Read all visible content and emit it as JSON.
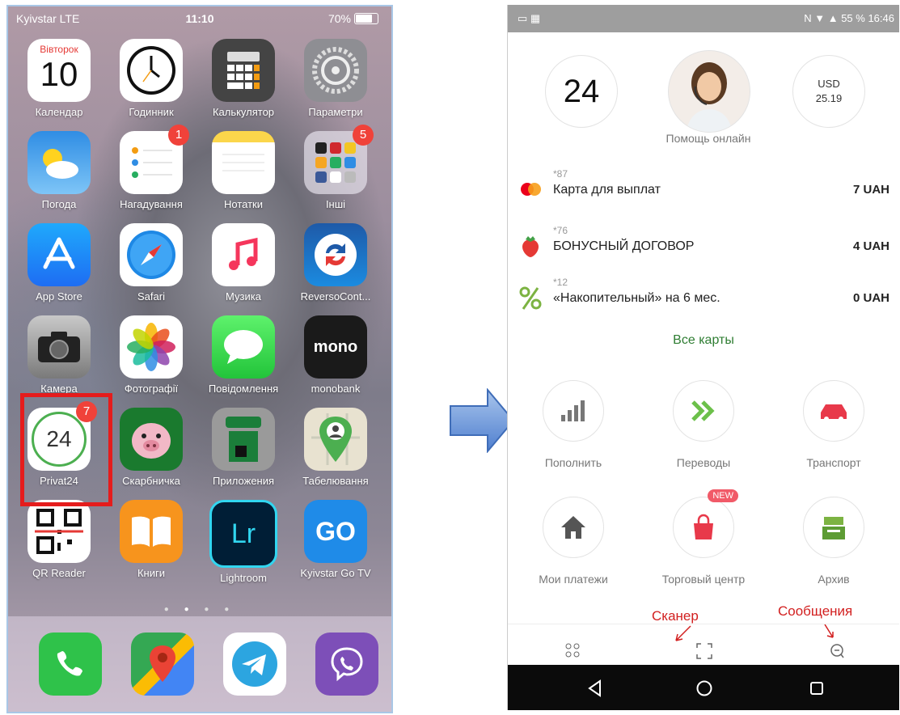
{
  "iphone": {
    "status": {
      "carrier": "Kyivstar  LTE",
      "time": "11:10",
      "battery": "70%"
    },
    "apps": [
      {
        "label": "Календар",
        "icon": "calendar-icon",
        "day": "Вівторок",
        "date": "10",
        "badge": null
      },
      {
        "label": "Годинник",
        "icon": "clock-icon",
        "badge": null
      },
      {
        "label": "Калькулятор",
        "icon": "calculator-icon",
        "badge": null
      },
      {
        "label": "Параметри",
        "icon": "settings-icon",
        "badge": null
      },
      {
        "label": "Погода",
        "icon": "weather-icon",
        "badge": null
      },
      {
        "label": "Нагадування",
        "icon": "reminders-icon",
        "badge": "1"
      },
      {
        "label": "Нотатки",
        "icon": "notes-icon",
        "badge": null
      },
      {
        "label": "Інші",
        "icon": "folder-icon",
        "badge": "5"
      },
      {
        "label": "App Store",
        "icon": "appstore-icon",
        "badge": null
      },
      {
        "label": "Safari",
        "icon": "safari-icon",
        "badge": null
      },
      {
        "label": "Музика",
        "icon": "music-icon",
        "badge": null
      },
      {
        "label": "ReversoCont...",
        "icon": "reverso-icon",
        "badge": null
      },
      {
        "label": "Камера",
        "icon": "camera-icon",
        "badge": null
      },
      {
        "label": "Фотографії",
        "icon": "photos-icon",
        "badge": null
      },
      {
        "label": "Повідомлення",
        "icon": "messages-icon",
        "badge": null
      },
      {
        "label": "monobank",
        "icon": "monobank-icon",
        "text": "mono",
        "badge": null
      },
      {
        "label": "Privat24",
        "icon": "privat24-icon",
        "text": "24",
        "badge": "7"
      },
      {
        "label": "Скарбничка",
        "icon": "piggy-icon",
        "badge": null
      },
      {
        "label": "Приложения",
        "icon": "privat-apps-icon",
        "badge": null
      },
      {
        "label": "Табелювання",
        "icon": "map-pin-icon",
        "badge": null
      },
      {
        "label": "QR Reader",
        "icon": "qr-icon",
        "badge": null
      },
      {
        "label": "Книги",
        "icon": "books-icon",
        "badge": null
      },
      {
        "label": "Lightroom",
        "icon": "lightroom-icon",
        "text": "Lr",
        "badge": null
      },
      {
        "label": "Kyivstar Go TV",
        "icon": "gotv-icon",
        "text": "GO",
        "badge": null
      }
    ],
    "dock": [
      "phone-icon",
      "google-maps-icon",
      "telegram-icon",
      "viber-icon"
    ]
  },
  "android": {
    "status": {
      "battery": "55 %",
      "time": "16:46"
    },
    "logo": "24",
    "help_label": "Помощь онлайн",
    "currency": {
      "code": "USD",
      "rate": "25.19"
    },
    "cards": [
      {
        "num": "*87",
        "name": "Карта для выплат",
        "amount": "7 UAH",
        "icon": "mastercard-icon"
      },
      {
        "num": "*76",
        "name": "БОНУСНЫЙ ДОГОВОР",
        "amount": "4 UAH",
        "icon": "strawberry-icon"
      },
      {
        "num": "*12",
        "name": "«Накопительный» на 6 мес.",
        "amount": "0 UAH",
        "icon": "percent-icon"
      }
    ],
    "all_cards": "Все карты",
    "services": [
      {
        "label": "Пополнить",
        "icon": "signal-bars-icon"
      },
      {
        "label": "Переводы",
        "icon": "chevrons-right-icon"
      },
      {
        "label": "Транспорт",
        "icon": "car-icon"
      },
      {
        "label": "Мои платежи",
        "icon": "home-icon"
      },
      {
        "label": "Торговый центр",
        "icon": "shopping-bag-icon",
        "badge": "NEW"
      },
      {
        "label": "Архив",
        "icon": "archive-icon"
      }
    ],
    "annotations": {
      "scanner": "Сканер",
      "messages": "Сообщения"
    },
    "colors": {
      "accent_green": "#2e7d32",
      "service_red": "#e8394a",
      "highlight_red": "#e51c1c"
    }
  }
}
